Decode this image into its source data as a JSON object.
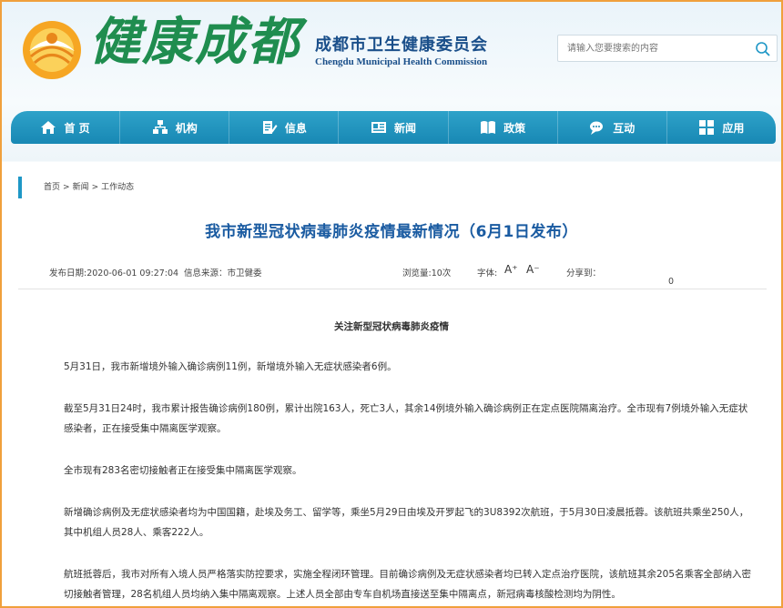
{
  "header": {
    "logo_text": "健康成都",
    "org_cn": "成都市卫生健康委员会",
    "org_en": "Chengdu Municipal Health Commission",
    "search_placeholder": "请输入您要搜索的内容"
  },
  "nav": {
    "items": [
      {
        "label": "首 页",
        "icon": "home-icon"
      },
      {
        "label": "机构",
        "icon": "org-icon"
      },
      {
        "label": "信息",
        "icon": "info-icon"
      },
      {
        "label": "新闻",
        "icon": "news-icon"
      },
      {
        "label": "政策",
        "icon": "policy-icon"
      },
      {
        "label": "互动",
        "icon": "chat-icon"
      },
      {
        "label": "应用",
        "icon": "apps-icon"
      }
    ]
  },
  "breadcrumb": {
    "home": "首页",
    "news": "新闻",
    "current": "工作动态",
    "sep": ">"
  },
  "article": {
    "title": "我市新型冠状病毒肺炎疫情最新情况（6月1日发布）",
    "date": "发布日期:2020-06-01 09:27:04",
    "source": "信息来源：市卫健委",
    "views": "浏览量:10次",
    "font_label": "字体:",
    "font_up": "A⁺",
    "font_down": "A⁻",
    "share_label": "分享到：",
    "share_count": "0",
    "subtitle": "关注新型冠状病毒肺炎疫情",
    "paragraphs": [
      "5月31日，我市新增境外输入确诊病例11例，新增境外输入无症状感染者6例。",
      "截至5月31日24时，我市累计报告确诊病例180例，累计出院163人，死亡3人，其余14例境外输入确诊病例正在定点医院隔离治疗。全市现有7例境外输入无症状感染者，正在接受集中隔离医学观察。",
      "全市现有283名密切接触者正在接受集中隔离医学观察。",
      "新增确诊病例及无症状感染者均为中国国籍，赴埃及务工、留学等，乘坐5月29日由埃及开罗起飞的3U8392次航班，于5月30日凌晨抵蓉。该航班共乘坐250人，其中机组人员28人、乘客222人。",
      "航班抵蓉后，我市对所有入境人员严格落实防控要求，实施全程闭环管理。目前确诊病例及无症状感染者均已转入定点治疗医院，该航班其余205名乘客全部纳入密切接触者管理，28名机组人员均纳入集中隔离观察。上述人员全部由专车自机场直接送至集中隔离点，新冠病毒核酸检测均为阴性。"
    ]
  },
  "colors": {
    "nav_blue": "#1e97c6",
    "title_blue": "#1a5ba1",
    "logo_green": "#1f8d4f",
    "frame_orange": "#f0a03c"
  }
}
